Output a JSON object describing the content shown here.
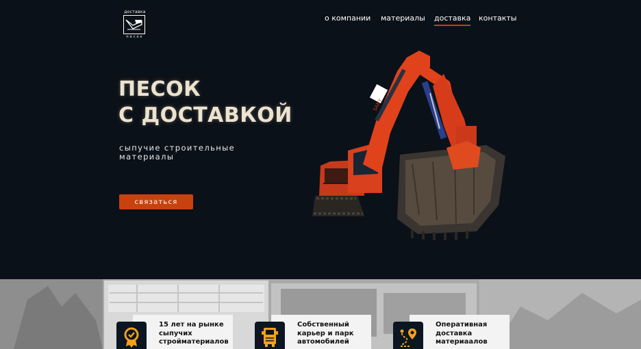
{
  "logo": {
    "top_text": "доставка",
    "bottom_text": "песок"
  },
  "nav": {
    "items": [
      {
        "label": "о компании",
        "active": false
      },
      {
        "label": "материалы",
        "active": false
      },
      {
        "label": "доставка",
        "active": true
      },
      {
        "label": "контакты",
        "active": false
      }
    ],
    "active_color": "#d03a13"
  },
  "hero": {
    "title_line1": "ПЕСОК",
    "title_line2": "С ДОСТАВКОЙ",
    "subtitle": "сыпучие строительные материалы",
    "cta_label": "связаться",
    "cta_color": "#c9410f",
    "image": "excavator-photo"
  },
  "features": [
    {
      "icon": "medal-badge-icon",
      "text": "15 лет на рынке сыпучих стройматериалов"
    },
    {
      "icon": "truck-icon",
      "text": "Собственный карьер и парк автомобилей"
    },
    {
      "icon": "route-pin-icon",
      "text": "Оперативная доставка материаалов"
    }
  ],
  "colors": {
    "background": "#0b1118",
    "accent": "#c9410f",
    "icon_orange": "#f4a11a",
    "title_text": "#ece2d0"
  }
}
